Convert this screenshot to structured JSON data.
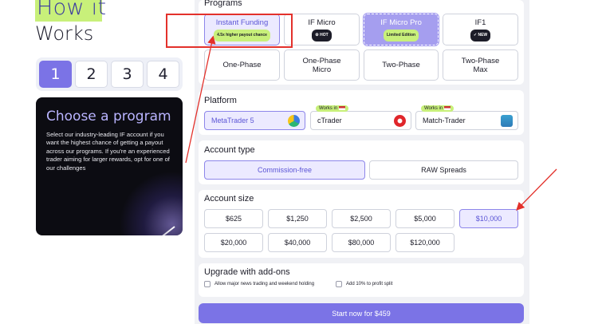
{
  "left": {
    "heading_line1": "How it",
    "heading_line2": "Works",
    "steps": [
      "1",
      "2",
      "3",
      "4"
    ],
    "active_step": "1",
    "card_title": "Choose a program",
    "card_body": "Select our industry-leading IF account if you want the highest chance of getting a payout across our programs. If you're an experienced trader aiming for larger rewards, opt for one of our challenges"
  },
  "programs": {
    "title": "Programs",
    "row1": [
      {
        "label": "Instant Funding",
        "pill": "4.5x higher payout chance",
        "selected": true
      },
      {
        "label": "IF Micro",
        "pill": "⚙ HOT"
      },
      {
        "label": "IF Micro Pro",
        "pill": "Limited Edition"
      },
      {
        "label": "IF1",
        "pill": "✓ NEW"
      }
    ],
    "row2": [
      {
        "label": "One-Phase"
      },
      {
        "label": "One-Phase Micro"
      },
      {
        "label": "Two-Phase"
      },
      {
        "label": "Two-Phase Max"
      }
    ]
  },
  "platform": {
    "title": "Platform",
    "options": [
      {
        "label": "MetaTrader 5",
        "badge": "",
        "selected": true
      },
      {
        "label": "cTrader",
        "badge": "Works in"
      },
      {
        "label": "Match-Trader",
        "badge": "Works in"
      }
    ]
  },
  "account_type": {
    "title": "Account type",
    "options": [
      {
        "label": "Commission-free",
        "selected": true
      },
      {
        "label": "RAW Spreads"
      }
    ]
  },
  "account_size": {
    "title": "Account size",
    "options": [
      "$625",
      "$1,250",
      "$2,500",
      "$5,000",
      "$10,000",
      "$20,000",
      "$40,000",
      "$80,000",
      "$120,000"
    ],
    "selected": "$10,000"
  },
  "addons": {
    "title": "Upgrade with add-ons",
    "items": [
      "Allow major news trading and weekend holding",
      "Add 10% to profit split"
    ]
  },
  "cta": {
    "label": "Start now for $459"
  },
  "colors": {
    "accent": "#7b73e6",
    "lime": "#c8f07a",
    "annotation": "#e3312b"
  }
}
